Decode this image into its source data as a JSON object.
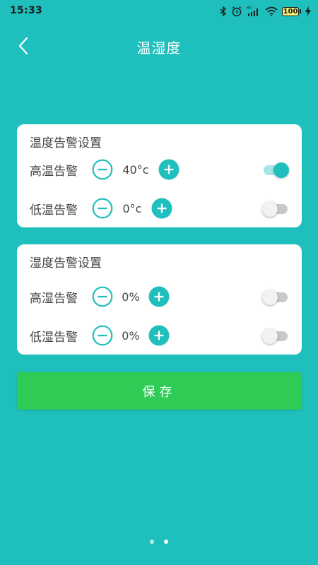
{
  "status_bar": {
    "time": "15:33",
    "battery": "100",
    "hd_label": "HD"
  },
  "header": {
    "title": "温湿度"
  },
  "temperature_card": {
    "title": "温度告警设置",
    "rows": [
      {
        "label": "高温告警",
        "value": "40°c",
        "toggle_on": true
      },
      {
        "label": "低温告警",
        "value": "0°c",
        "toggle_on": false
      }
    ]
  },
  "humidity_card": {
    "title": "湿度告警设置",
    "rows": [
      {
        "label": "高湿告警",
        "value": "0%",
        "toggle_on": false
      },
      {
        "label": "低湿告警",
        "value": "0%",
        "toggle_on": false
      }
    ]
  },
  "save_button": {
    "label": "保存"
  },
  "icons": {
    "minus": "minus-circle-icon",
    "plus": "plus-circle-icon",
    "back": "chevron-left-icon"
  },
  "colors": {
    "background": "#1EBFBD",
    "accent": "#1EBFBD",
    "save_button": "#2ECC55",
    "card": "#FFFFFF"
  },
  "page_indicator": {
    "count": 2
  }
}
